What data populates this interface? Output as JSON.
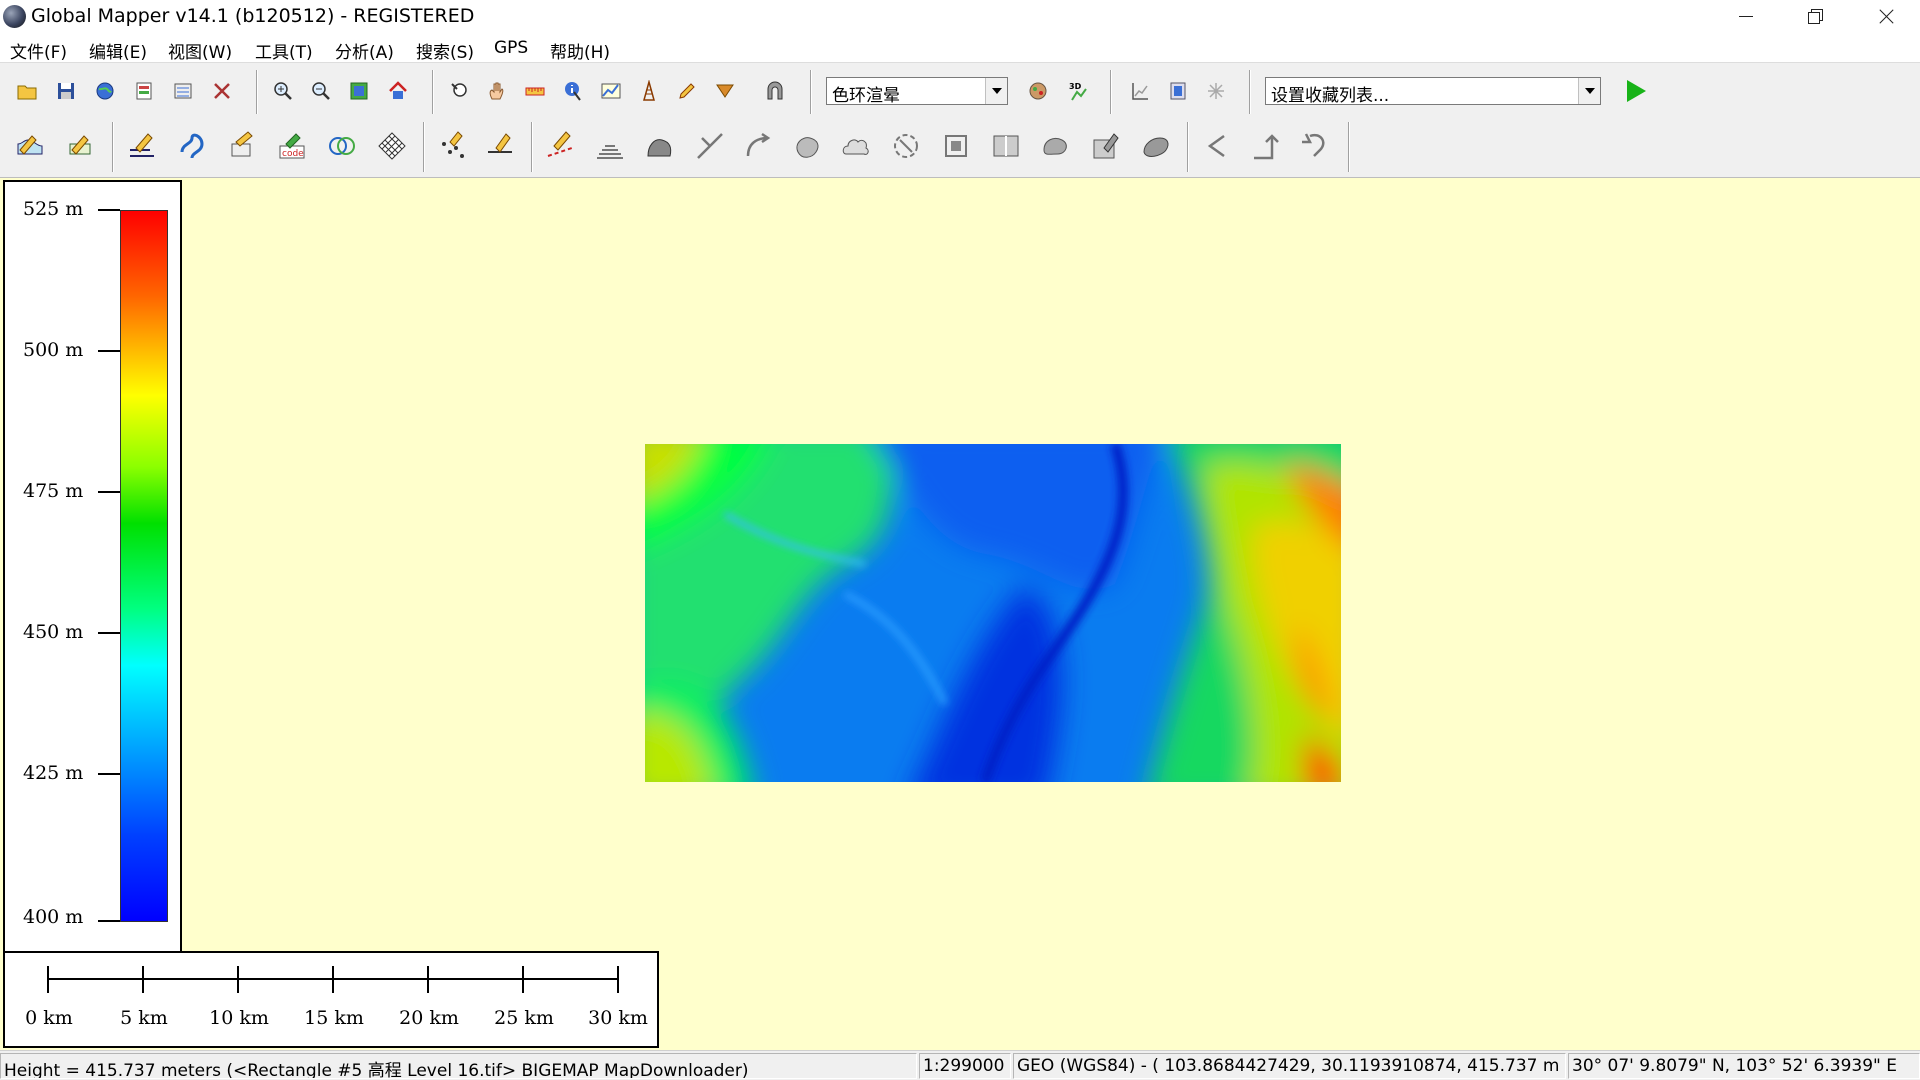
{
  "window": {
    "title": "Global Mapper v14.1 (b120512) - REGISTERED"
  },
  "menu": [
    "文件(F)",
    "编辑(E)",
    "视图(W)",
    "工具(T)",
    "分析(A)",
    "搜索(S)",
    "GPS",
    "帮助(H)"
  ],
  "toolbar": {
    "shader_value": "色环渲晕",
    "favorites_value": "设置收藏列表..."
  },
  "legend": {
    "labels": [
      "525 m",
      "500 m",
      "475 m",
      "450 m",
      "425 m",
      "400 m"
    ],
    "range_m": [
      400,
      525
    ],
    "colors": [
      "#0000ff",
      "#00ffff",
      "#00ff00",
      "#ffff00",
      "#ff0000"
    ]
  },
  "scale": {
    "labels": [
      "0 km",
      "5 km",
      "10 km",
      "15 km",
      "20 km",
      "25 km",
      "30 km"
    ]
  },
  "status": {
    "height": "Height = 415.737 meters (<Rectangle #5 高程 Level 16.tif> BIGEMAP MapDownloader)",
    "scale": "1:299000",
    "geo": "GEO (WGS84) - ( 103.8684427429, 30.1193910874, 415.737 m )",
    "dms": "30° 07' 9.8079\" N, 103° 52' 6.3939\" E"
  }
}
